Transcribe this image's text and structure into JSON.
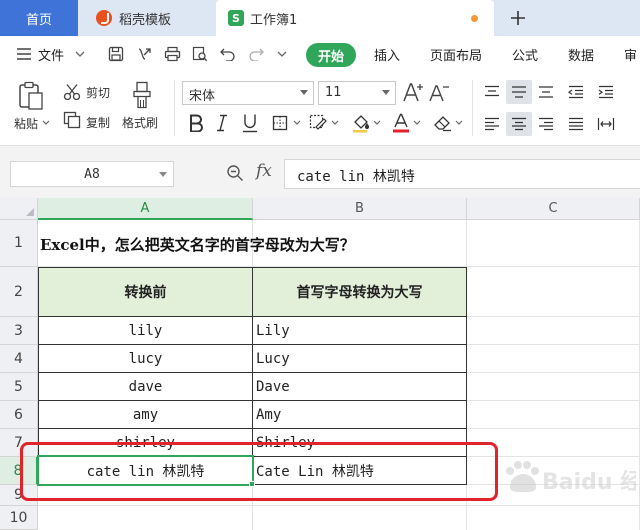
{
  "tabs": [
    {
      "label": "首页"
    },
    {
      "label": "稻壳模板"
    },
    {
      "label": "工作簿1"
    }
  ],
  "menu": {
    "file": "文件",
    "start": "开始",
    "items": [
      "插入",
      "页面布局",
      "公式",
      "数据",
      "审"
    ]
  },
  "ribbon": {
    "paste": "粘贴",
    "cut": "剪切",
    "copy": "复制",
    "format_painter": "格式刷",
    "font_name": "宋体",
    "font_size": "11"
  },
  "formula_bar": {
    "cell_ref": "A8",
    "fx": "fx",
    "content": "cate lin 林凯特"
  },
  "grid": {
    "columns": [
      "A",
      "B",
      "C"
    ],
    "rows": [
      "1",
      "2",
      "3",
      "4",
      "5",
      "6",
      "7",
      "8",
      "9",
      "10"
    ],
    "title": "Excel中，怎么把英文名字的首字母改为大写？",
    "header_a": "转换前",
    "header_b": "首写字母转换为大写",
    "data": [
      {
        "a": "lily",
        "b": "Lily"
      },
      {
        "a": "lucy",
        "b": "Lucy"
      },
      {
        "a": "dave",
        "b": "Dave"
      },
      {
        "a": "amy",
        "b": "Amy"
      },
      {
        "a": "shirley",
        "b": "Shirley"
      },
      {
        "a": "cate lin 林凯特",
        "b": "Cate Lin 林凯特"
      }
    ]
  },
  "colors": {
    "accent_green": "#2fa65a",
    "tab_blue": "#3f73d8",
    "annotation_red": "#e0242a",
    "header_fill": "#e2efd9"
  },
  "watermark": "Baidu 经验"
}
